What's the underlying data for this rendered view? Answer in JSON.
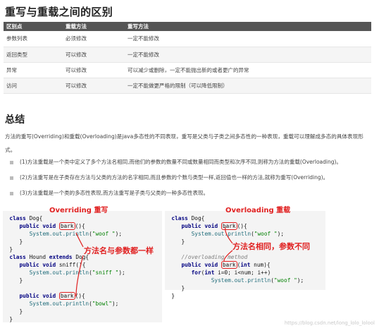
{
  "title": "重写与重载之间的区别",
  "table": {
    "headers": [
      "区别点",
      "重载方法",
      "重写方法"
    ],
    "rows": [
      [
        "参数列表",
        "必须修改",
        "一定不能修改"
      ],
      [
        "返回类型",
        "可以修改",
        "一定不能修改"
      ],
      [
        "异常",
        "可以修改",
        "可以减少或删除，一定不能抛出新的或者更广的异常"
      ],
      [
        "访问",
        "可以修改",
        "一定不能做更严格的限制（可以降低限制）"
      ]
    ]
  },
  "summary": {
    "heading": "总结",
    "paragraph": "方法的重写(Overriding)和重载(Overloading)是java多态性的不同表现，重写是父类与子类之间多态性的一种表现，重载可以理解成多态的具体表现形式。",
    "bullets": [
      "(1)方法重载是一个类中定义了多个方法名相同,而他们的参数的数量不同或数量相同而类型和次序不同,则称为方法的重载(Overloading)。",
      "(2)方法重写是在子类存在方法与父类的方法的名字相同,而且参数的个数与类型一样,返回值也一样的方法,就称为重写(Overriding)。",
      "(3)方法重载是一个类的多态性表现,而方法重写是子类与父类的一种多态性表现。"
    ]
  },
  "annotations": {
    "overriding": "Overriding  重写",
    "overloading": "Overloading  重载",
    "same_name_params": "方法名与参数都一样",
    "same_name_diff_params": "方法名相同，参数不同"
  },
  "code_left": {
    "kw_class": "class",
    "kw_extends": "extends",
    "kw_public": "public",
    "kw_void": "void",
    "dog": "Dog",
    "hound": "Hound",
    "m_bark": "bark",
    "m_sniff": "sniff",
    "sys": "System.out.println",
    "s_woof": "\"woof \"",
    "s_sniff": "\"sniff \"",
    "s_bowl": "\"bowl\""
  },
  "code_right": {
    "comment": "//overloading method",
    "kw_int": "int",
    "kw_for": "for",
    "params": "num",
    "loop": "i=0; i<num; i++"
  },
  "watermark": "https://blog.csdn.net/long_lolo_lolool"
}
